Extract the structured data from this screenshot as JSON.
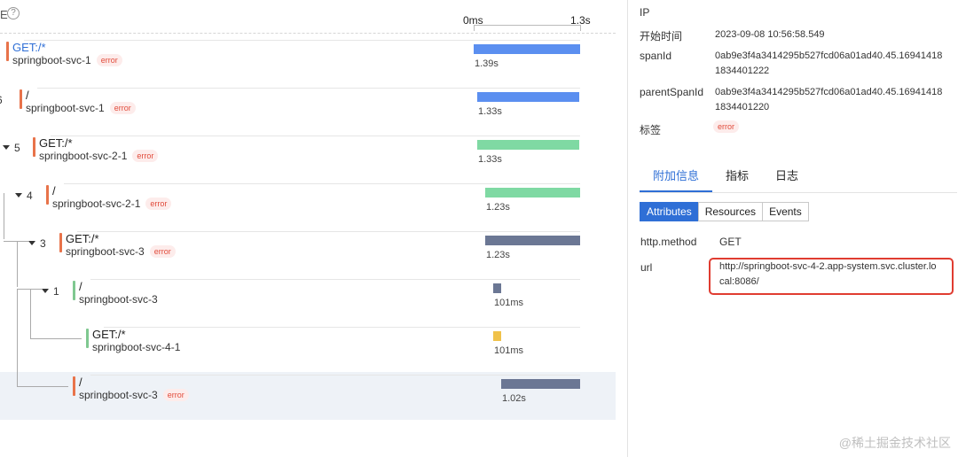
{
  "timeline": {
    "header_label": "E",
    "help_icon": "?",
    "scale_start": "0ms",
    "scale_end": "1.3s"
  },
  "spans": [
    {
      "toggle": "",
      "name": "GET:/*",
      "service": "springboot-svc-1",
      "error": "error",
      "duration": "1.39s",
      "color": "#5b8ff0",
      "mark": "#e8734a",
      "name_link": true,
      "level": 0,
      "bar_start": 0.0,
      "bar_ratio": 1.0
    },
    {
      "toggle": "6",
      "name": "/",
      "service": "springboot-svc-1",
      "error": "error",
      "duration": "1.33s",
      "color": "#5b8ff0",
      "mark": "#e8734a",
      "level": 1,
      "bar_start": 0.035,
      "bar_ratio": 0.96
    },
    {
      "toggle": "5",
      "name": "GET:/*",
      "service": "springboot-svc-2-1",
      "error": "error",
      "duration": "1.33s",
      "color": "#7fd9a3",
      "mark": "#e8734a",
      "level": 2,
      "bar_start": 0.035,
      "bar_ratio": 0.96
    },
    {
      "toggle": "4",
      "name": "/",
      "service": "springboot-svc-2-1",
      "error": "error",
      "duration": "1.23s",
      "color": "#7fd9a3",
      "mark": "#e8734a",
      "level": 3,
      "bar_start": 0.11,
      "bar_ratio": 0.89
    },
    {
      "toggle": "3",
      "name": "GET:/*",
      "service": "springboot-svc-3",
      "error": "error",
      "duration": "1.23s",
      "color": "#6b7794",
      "mark": "#e8734a",
      "level": 4,
      "bar_start": 0.11,
      "bar_ratio": 0.89
    },
    {
      "toggle": "1",
      "name": "/",
      "service": "springboot-svc-3",
      "error": "",
      "duration": "101ms",
      "color": "#6b7794",
      "mark": "#7fc890",
      "level": 5,
      "bar_start": 0.18,
      "bar_ratio": 0.07
    },
    {
      "toggle": "",
      "name": "GET:/*",
      "service": "springboot-svc-4-1",
      "error": "",
      "duration": "101ms",
      "color": "#f0c24a",
      "mark": "#7fc890",
      "level": 6,
      "bar_start": 0.18,
      "bar_ratio": 0.07
    },
    {
      "toggle": "",
      "name": "/",
      "service": "springboot-svc-3",
      "error": "error",
      "duration": "1.02s",
      "color": "#6b7794",
      "mark": "#e8734a",
      "level": 5,
      "bar_start": 0.26,
      "bar_ratio": 0.74,
      "selected": true
    }
  ],
  "detail": {
    "fields": [
      {
        "key": "IP",
        "value": ""
      },
      {
        "key": "开始时间",
        "value": "2023-09-08 10:56:58.549"
      },
      {
        "key": "spanId",
        "value": "0ab9e3f4a3414295b527fcd06a01ad40.45.169414181834401222"
      },
      {
        "key": "parentSpanId",
        "value": "0ab9e3f4a3414295b527fcd06a01ad40.45.169414181834401220"
      },
      {
        "key": "标签",
        "value": ""
      }
    ],
    "tag_error": "error",
    "tabs": [
      "附加信息",
      "指标",
      "日志"
    ],
    "active_tab": 0,
    "segments": [
      "Attributes",
      "Resources",
      "Events"
    ],
    "active_segment": 0,
    "attributes": [
      {
        "key": "http.method",
        "value": "GET"
      },
      {
        "key": "url",
        "value": "http://springboot-svc-4-2.app-system.svc.cluster.local:8086/"
      }
    ]
  },
  "watermark": "@稀土掘金技术社区"
}
